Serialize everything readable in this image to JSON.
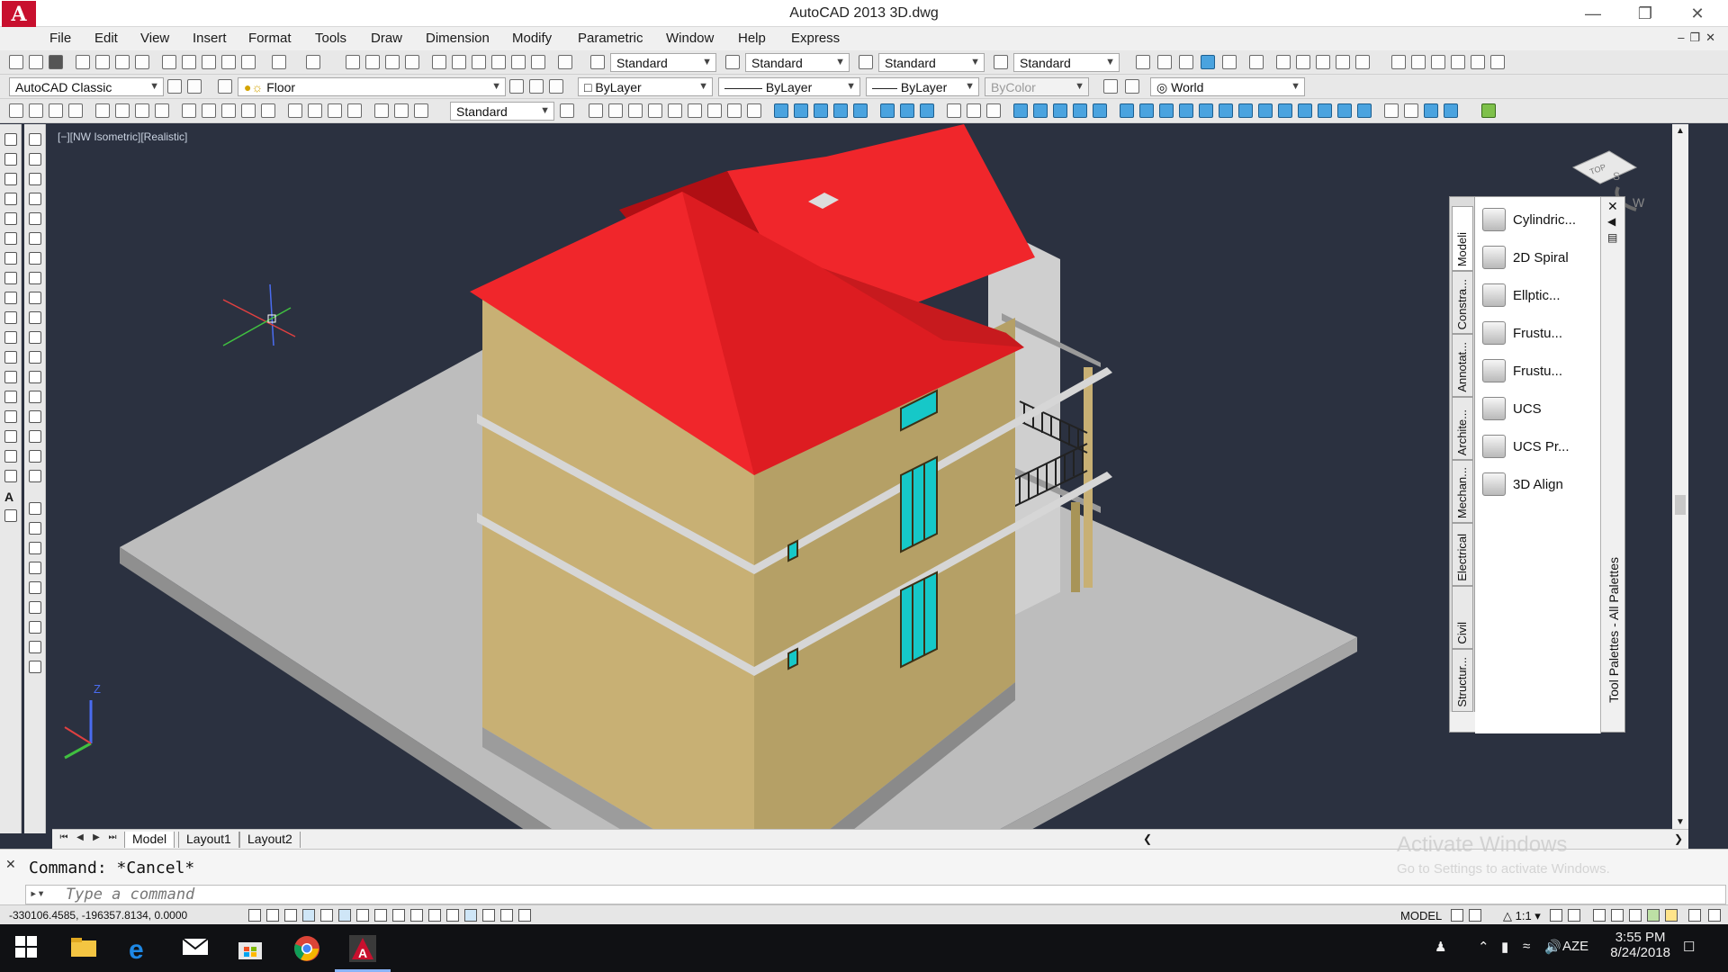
{
  "window": {
    "title": "AutoCAD 2013    3D.dwg",
    "logo_letter": "A"
  },
  "menu": [
    "File",
    "Edit",
    "View",
    "Insert",
    "Format",
    "Tools",
    "Draw",
    "Dimension",
    "Modify",
    "Parametric",
    "Window",
    "Help",
    "Express"
  ],
  "toolbar": {
    "text_style": "Standard",
    "dim_style": "Standard",
    "table_style": "Standard",
    "mleader_style": "Standard",
    "workspace": "AutoCAD Classic",
    "layer": "Floor",
    "color": "ByLayer",
    "linetype": "ByLayer",
    "lineweight": "ByLayer",
    "plotstyle": "ByColor",
    "ucs": "World",
    "dim_style_2": "Standard"
  },
  "viewport": {
    "label": "[−][NW Isometric][Realistic]",
    "cube_top": "TOP",
    "axis_z": "Z",
    "compass_w": "W",
    "compass_s": "S"
  },
  "palette": {
    "title": "Tool Palettes - All Palettes",
    "tabs": [
      "Modeli",
      "Constra...",
      "Annotat...",
      "Archite...",
      "Mechan...",
      "Electrical",
      "Civil",
      "Structur..."
    ],
    "active_tab": "Modeli",
    "items": [
      "Cylindric...",
      "2D Spiral",
      "Ellptic...",
      "Frustu...",
      "Frustu...",
      "UCS",
      "UCS Pr...",
      "3D Align"
    ]
  },
  "layout_tabs": [
    "Model",
    "Layout1",
    "Layout2"
  ],
  "command": {
    "history": "Command: *Cancel*",
    "placeholder": "Type a command"
  },
  "watermark": {
    "line1": "Activate Windows",
    "line2": "Go to Settings to activate Windows."
  },
  "status": {
    "coords": "-330106.4585, -196357.8134, 0.0000",
    "model": "MODEL",
    "scale": "1:1"
  },
  "taskbar": {
    "language": "AZE",
    "time": "3:55 PM",
    "date": "8/24/2018"
  },
  "colors": {
    "roof": "#f0262b",
    "walls": "#c8b074",
    "window_glass": "#16c8c8",
    "base": "#c8c8c8",
    "viewport_bg": "#2b3140"
  }
}
